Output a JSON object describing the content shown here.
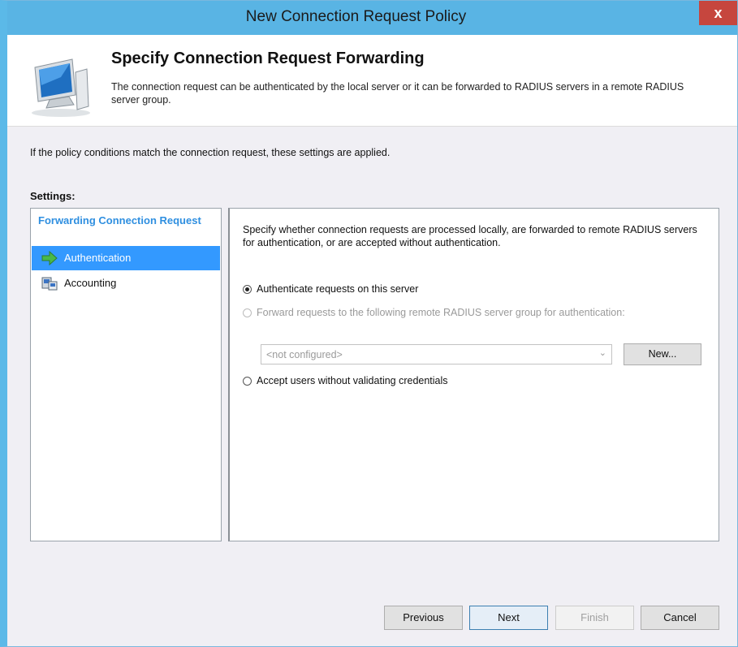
{
  "window": {
    "title": "New Connection Request Policy",
    "close_label": "x"
  },
  "header": {
    "title": "Specify Connection Request Forwarding",
    "description": "The connection request can be authenticated by the local server or it can be forwarded to RADIUS servers in a remote RADIUS server group."
  },
  "intro_text": "If the policy conditions match the connection request, these settings are applied.",
  "settings_label": "Settings:",
  "sidebar": {
    "heading": "Forwarding Connection Request",
    "items": [
      {
        "label": "Authentication",
        "icon": "green-arrow-icon",
        "selected": true
      },
      {
        "label": "Accounting",
        "icon": "accounting-icon",
        "selected": false
      }
    ]
  },
  "panel": {
    "description": "Specify whether connection requests are processed locally, are forwarded to remote RADIUS servers for authentication, or are accepted without authentication.",
    "options": [
      {
        "label": "Authenticate requests on this server",
        "checked": true,
        "enabled": true
      },
      {
        "label": "Forward requests to the following remote RADIUS server group for authentication:",
        "checked": false,
        "enabled": false
      },
      {
        "label": "Accept users without validating credentials",
        "checked": false,
        "enabled": true
      }
    ],
    "server_group_select": {
      "value": "<not configured>",
      "enabled": false
    },
    "new_button": "New..."
  },
  "footer": {
    "previous": "Previous",
    "next": "Next",
    "finish": "Finish",
    "cancel": "Cancel"
  },
  "colors": {
    "titlebar": "#59b4e4",
    "selection": "#3399ff",
    "close": "#c6463e",
    "heading": "#2f8fe0"
  }
}
